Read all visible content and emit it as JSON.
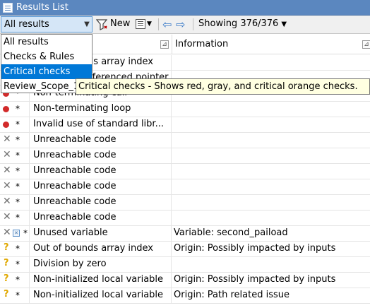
{
  "window": {
    "title": "Results List"
  },
  "toolbar": {
    "filter_value": "All results",
    "new_label": "New",
    "showing_label": "Showing 376/376"
  },
  "table": {
    "information_header": "Information",
    "rows": [
      {
        "icon": "red-dot",
        "star": "*",
        "check": "Out of bounds array index",
        "info": ""
      },
      {
        "icon": "red-dot",
        "star": "*",
        "check": "Illegally dereferenced pointer",
        "info": ""
      },
      {
        "icon": "red-dot",
        "star": "*",
        "check": "Non-terminating call",
        "info": ""
      },
      {
        "icon": "red-dot",
        "star": "*",
        "check": "Non-terminating loop",
        "info": ""
      },
      {
        "icon": "red-dot",
        "star": "*",
        "check": "Invalid use of standard libr...",
        "info": ""
      },
      {
        "icon": "gray-x",
        "star": "*",
        "check": "Unreachable code",
        "info": ""
      },
      {
        "icon": "gray-x",
        "star": "*",
        "check": "Unreachable code",
        "info": ""
      },
      {
        "icon": "gray-x",
        "star": "*",
        "check": "Unreachable code",
        "info": ""
      },
      {
        "icon": "gray-x",
        "star": "*",
        "check": "Unreachable code",
        "info": ""
      },
      {
        "icon": "gray-x",
        "star": "*",
        "check": "Unreachable code",
        "info": ""
      },
      {
        "icon": "gray-x",
        "star": "*",
        "check": "Unreachable code",
        "info": ""
      },
      {
        "icon": "gray-x-justified",
        "star": "*",
        "check": "Unused variable",
        "info": "Variable: second_paiload"
      },
      {
        "icon": "orange-question",
        "star": "*",
        "check": "Out of bounds array index",
        "info": "Origin: Possibly impacted by inputs"
      },
      {
        "icon": "orange-question",
        "star": "*",
        "check": "Division by zero",
        "info": ""
      },
      {
        "icon": "orange-question",
        "star": "*",
        "check": "Non-initialized local variable",
        "info": "Origin: Possibly impacted by inputs"
      },
      {
        "icon": "orange-question",
        "star": "*",
        "check": "Non-initialized local variable",
        "info": "Origin: Path related issue"
      }
    ]
  },
  "dropdown": {
    "options": [
      "All results",
      "Checks & Rules",
      "Critical checks",
      "Review_Scope_1"
    ],
    "selected_index": 2
  },
  "tooltip": {
    "text": "Critical checks - Shows red, gray, and critical orange checks."
  },
  "colors": {
    "title_bar": "#5b87bf",
    "selection": "#0078d7",
    "red_check": "#d22a2a",
    "orange_check": "#e0a800",
    "gray_check": "#707070",
    "tooltip_bg": "#ffffe1"
  }
}
